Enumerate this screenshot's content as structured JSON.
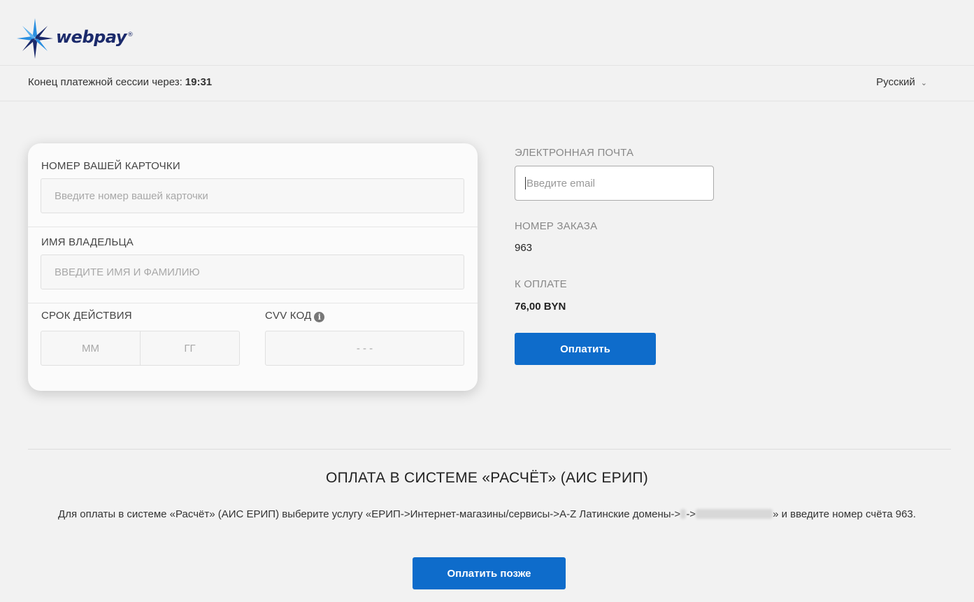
{
  "header": {
    "logo_text": "webpay",
    "logo_mark": "®"
  },
  "session": {
    "label": "Конец платежной сессии через:",
    "time": "19:31"
  },
  "language": {
    "current": "Русский"
  },
  "card_form": {
    "card_number_label": "НОМЕР ВАШЕЙ КАРТОЧКИ",
    "card_number_placeholder": "Введите номер вашей карточки",
    "holder_label": "ИМЯ ВЛАДЕЛЬЦА",
    "holder_placeholder": "ВВЕДИТЕ ИМЯ И ФАМИЛИЮ",
    "expiry_label": "СРОК ДЕЙСТВИЯ",
    "month_placeholder": "ММ",
    "year_placeholder": "ГГ",
    "cvv_label": "CVV КОД",
    "cvv_placeholder": "- - -"
  },
  "order": {
    "email_label": "ЭЛЕКТРОННАЯ ПОЧТА",
    "email_placeholder": "Введите email",
    "order_number_label": "НОМЕР ЗАКАЗА",
    "order_number": "963",
    "amount_label": "К ОПЛАТЕ",
    "amount": "76,00 BYN",
    "pay_button": "Оплатить"
  },
  "erip": {
    "title": "ОПЛАТА В СИСТЕМЕ «РАСЧЁТ» (АИС ЕРИП)",
    "text_before": "Для оплаты в системе «Расчёт» (АИС ЕРИП) выберите услугу «ЕРИП->Интернет-магазины/сервисы->A-Z Латинские домены->",
    "text_mid": "->",
    "text_after": "» и введите номер счёта 963.",
    "pay_later_button": "Оплатить позже"
  },
  "colors": {
    "accent": "#0e6ccb",
    "logo_navy": "#1b2a6b",
    "logo_blue": "#2a8fe0"
  }
}
